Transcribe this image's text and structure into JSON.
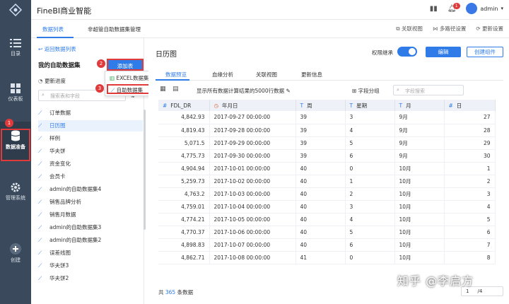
{
  "app": {
    "title": "FineBI商业智能",
    "notification_count": "1",
    "user": "admin"
  },
  "leftnav": [
    {
      "label": "目录",
      "icon": "list-icon"
    },
    {
      "label": "仪表板",
      "icon": "dashboard-icon"
    },
    {
      "label": "数据准备",
      "icon": "database-icon"
    },
    {
      "label": "管理系统",
      "icon": "gear-icon"
    },
    {
      "label": "创建",
      "icon": "plus-icon"
    }
  ],
  "subnav": {
    "tabs": [
      "数据列表",
      "非超管自助数据集管理"
    ],
    "right": [
      "关联视图",
      "多路径设置",
      "更新设置"
    ]
  },
  "sidepanel": {
    "back": "返回数据列表",
    "title": "我的自助数据集",
    "update": "更新进度",
    "search_placeholder": "搜索表和字段",
    "add_button": "添加表",
    "dropdown": [
      "EXCEL数据集",
      "自助数据集"
    ],
    "items": [
      "订单数据",
      "日历图",
      "样例",
      "华夫饼",
      "资金变化",
      "会员卡",
      "admin的自助数据集4",
      "销售品牌分析",
      "销售月数据",
      "admin的自助数据集3",
      "admin的自助数据集2",
      "误差线图",
      "华夫饼3",
      "华夫饼2"
    ],
    "selected_index": 1
  },
  "steps": [
    "1",
    "2",
    "3"
  ],
  "main": {
    "title": "日历图",
    "permission_label": "权限继承",
    "edit_button": "编辑",
    "create_button": "创建组件",
    "tabs": [
      "数据预览",
      "血缘分析",
      "关联视图",
      "更新信息"
    ],
    "info": "显示所有数据计算结果的5000行数据",
    "group_label": "字段分组",
    "search_placeholder": "字段搜索",
    "columns": [
      {
        "icon": "#",
        "name": "FDL_DR"
      },
      {
        "icon": "◷",
        "name": "年月日"
      },
      {
        "icon": "T",
        "name": "周"
      },
      {
        "icon": "T",
        "name": "星期"
      },
      {
        "icon": "T",
        "name": "月"
      },
      {
        "icon": "#",
        "name": "日"
      }
    ],
    "rows": [
      [
        "4,842.93",
        "2017-09-27 00:00:00",
        "39",
        "3",
        "9月",
        "27"
      ],
      [
        "4,819.43",
        "2017-09-28 00:00:00",
        "39",
        "4",
        "9月",
        "28"
      ],
      [
        "5,071.5",
        "2017-09-29 00:00:00",
        "39",
        "5",
        "9月",
        "29"
      ],
      [
        "4,775.73",
        "2017-09-30 00:00:00",
        "39",
        "6",
        "9月",
        "30"
      ],
      [
        "4,904.94",
        "2017-10-01 00:00:00",
        "40",
        "0",
        "10月",
        "1"
      ],
      [
        "5,259.73",
        "2017-10-02 00:00:00",
        "40",
        "1",
        "10月",
        "2"
      ],
      [
        "4,763.2",
        "2017-10-03 00:00:00",
        "40",
        "2",
        "10月",
        "3"
      ],
      [
        "4,759.01",
        "2017-10-04 00:00:00",
        "40",
        "3",
        "10月",
        "4"
      ],
      [
        "4,774.21",
        "2017-10-05 00:00:00",
        "40",
        "4",
        "10月",
        "5"
      ],
      [
        "4,770.37",
        "2017-10-06 00:00:00",
        "40",
        "5",
        "10月",
        "6"
      ],
      [
        "4,898.83",
        "2017-10-07 00:00:00",
        "40",
        "6",
        "10月",
        "7"
      ],
      [
        "4,862.71",
        "2017-10-08 00:00:00",
        "41",
        "0",
        "10月",
        "8"
      ]
    ],
    "footer_prefix": "共",
    "footer_count": "365",
    "footer_suffix": "条数据",
    "page": "1",
    "pages": "/4"
  },
  "watermark": "知乎 @李启方"
}
